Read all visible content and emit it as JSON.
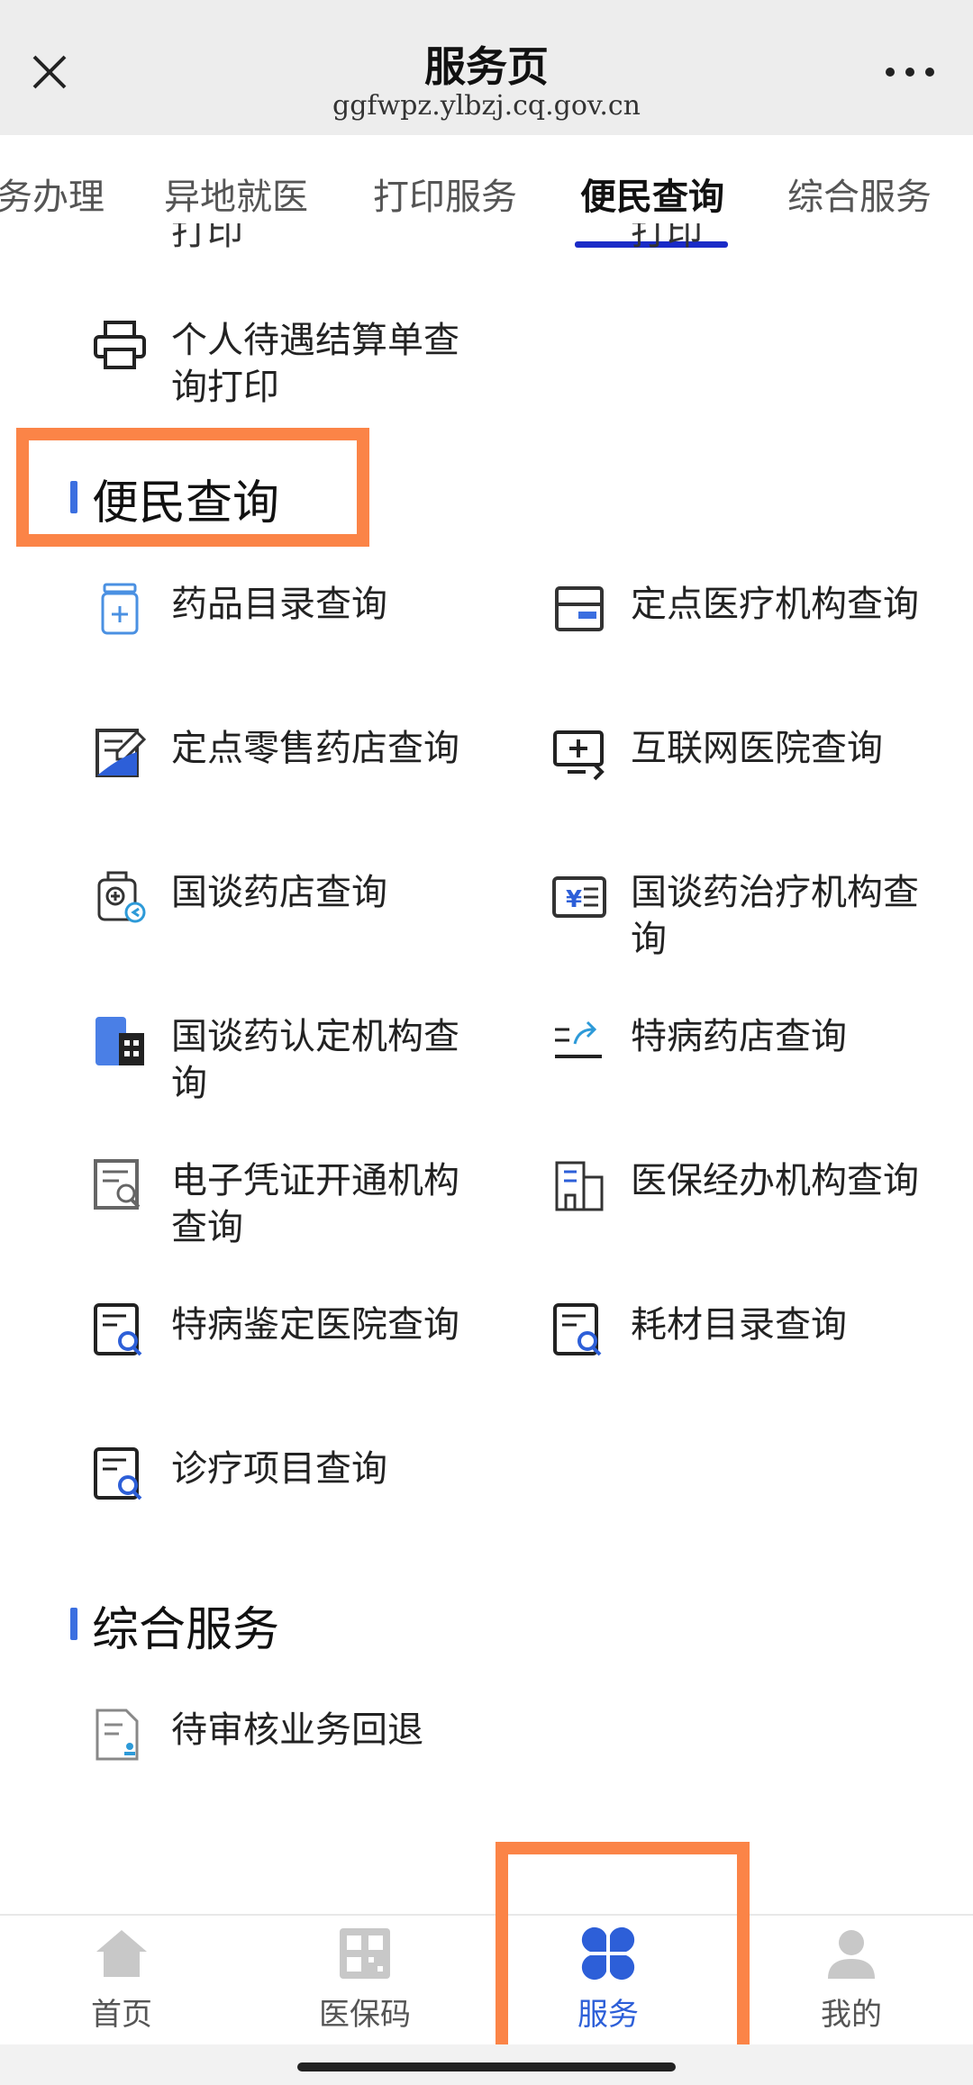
{
  "header": {
    "title": "服务页",
    "url": "ggfwpz.ylbzj.cq.gov.cn"
  },
  "tabs": [
    {
      "label": "务办理"
    },
    {
      "label": "异地就医"
    },
    {
      "label": "打印服务"
    },
    {
      "label": "便民查询",
      "active": true
    },
    {
      "label": "综合服务"
    }
  ],
  "clipped_prev": {
    "left": "打印",
    "right": "打印"
  },
  "print_item": {
    "label": "个人待遇结算单查询打印",
    "icon": "printer-icon"
  },
  "sections": {
    "query": {
      "title": "便民查询",
      "items": [
        {
          "label": "药品目录查询",
          "icon": "medicine-bottle-icon"
        },
        {
          "label": "定点医疗机构查询",
          "icon": "box-icon"
        },
        {
          "label": "定点零售药店查询",
          "icon": "edit-document-icon"
        },
        {
          "label": "互联网医院查询",
          "icon": "monitor-plus-icon"
        },
        {
          "label": "国谈药店查询",
          "icon": "pharmacy-icon"
        },
        {
          "label": "国谈药治疗机构查询",
          "icon": "yen-card-icon"
        },
        {
          "label": "国谈药认定机构查询",
          "icon": "building-icon"
        },
        {
          "label": "特病药店查询",
          "icon": "share-list-icon"
        },
        {
          "label": "电子凭证开通机构查询",
          "icon": "document-search-icon"
        },
        {
          "label": "医保经办机构查询",
          "icon": "office-building-icon"
        },
        {
          "label": "特病鉴定医院查询",
          "icon": "document-search-icon"
        },
        {
          "label": "耗材目录查询",
          "icon": "document-search-icon"
        },
        {
          "label": "诊疗项目查询",
          "icon": "document-search-icon"
        }
      ]
    },
    "general": {
      "title": "综合服务",
      "items": [
        {
          "label": "待审核业务回退",
          "icon": "document-stamp-icon"
        }
      ]
    }
  },
  "bottom_nav": [
    {
      "label": "首页",
      "icon": "home-icon"
    },
    {
      "label": "医保码",
      "icon": "qr-code-icon"
    },
    {
      "label": "服务",
      "icon": "four-petal-icon",
      "active": true
    },
    {
      "label": "我的",
      "icon": "user-icon"
    }
  ],
  "colors": {
    "accent": "#2d5fd8",
    "highlight": "#fb8447",
    "tab_underline": "#1a2bc7"
  }
}
